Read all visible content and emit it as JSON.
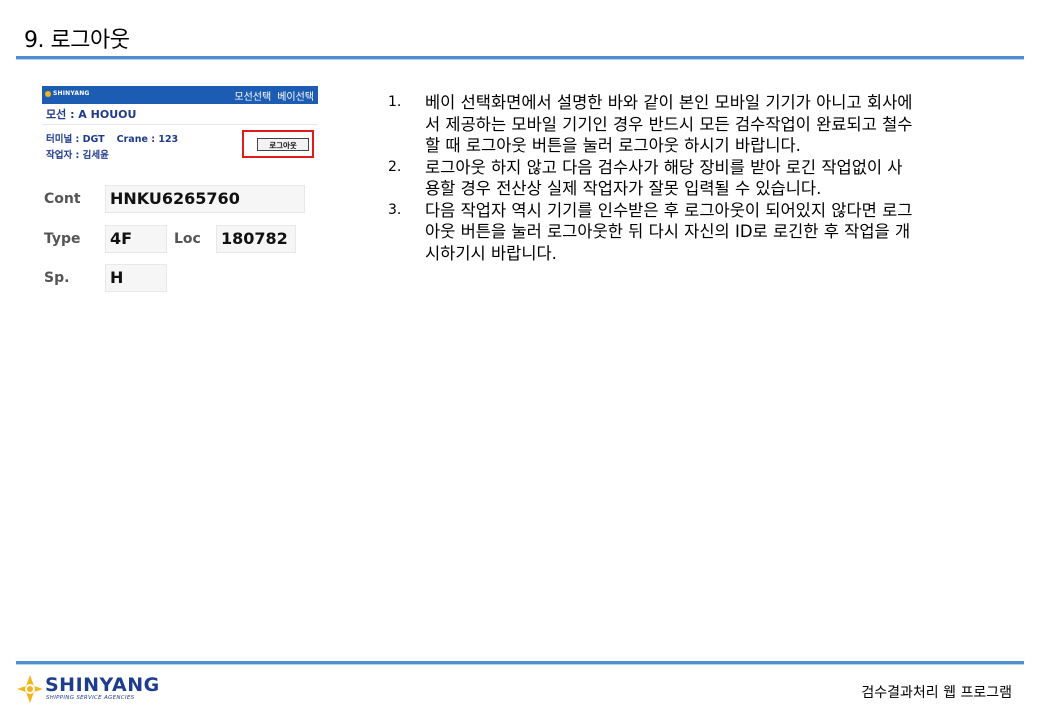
{
  "slide": {
    "title": "9. 로그아웃",
    "footer_caption": "검수결과처리 웹 프로그램"
  },
  "app": {
    "logo_text": "SHINYANG",
    "tabs": [
      "모선선택",
      "베이선택"
    ],
    "vessel": "모선 : A HOUOU",
    "terminal": "터미널 : DGT",
    "crane": "Crane : 123",
    "worker": "작업자 : 김세윤",
    "logout_button": "로그아웃",
    "fields": {
      "cont_label": "Cont",
      "cont_value": "HNKU6265760",
      "type_label": "Type",
      "type_value": "4F",
      "loc_label": "Loc",
      "loc_value": "180782",
      "sp_label": "Sp.",
      "sp_value": "H"
    }
  },
  "instructions": [
    {
      "num": "1.",
      "lines": [
        "베이 선택화면에서 설명한 바와 같이 본인 모바일 기기가 아니고 회사에",
        "서 제공하는 모바일 기기인 경우 반드시 모든 검수작업이 완료되고 철수",
        "할 때 로그아웃 버튼을 눌러 로그아웃 하시기 바랍니다."
      ]
    },
    {
      "num": "2.",
      "lines": [
        "로그아웃 하지 않고 다음 검수사가 해당 장비를 받아 로긴 작업없이 사",
        "용할 경우 전산상 실제 작업자가 잘못 입력될 수 있습니다."
      ]
    },
    {
      "num": "3.",
      "lines": [
        "다음 작업자 역시 기기를 인수받은 후 로그아웃이 되어있지 않다면 로그",
        "아웃 버튼을 눌러 로그아웃한 뒤 다시 자신의 ID로 로긴한 후 작업을 개",
        "시하기시 바랍니다."
      ]
    }
  ],
  "footer_logo": {
    "brand": "SHINYANG",
    "tagline": "SHIPPING SERVICE AGENCIES"
  },
  "colors": {
    "accent_rule": "#4f90cf",
    "app_header": "#1d5cb3",
    "highlight": "#e01b1b",
    "brand": "#1e3d8f",
    "logo_mark": "#f3b51b"
  }
}
